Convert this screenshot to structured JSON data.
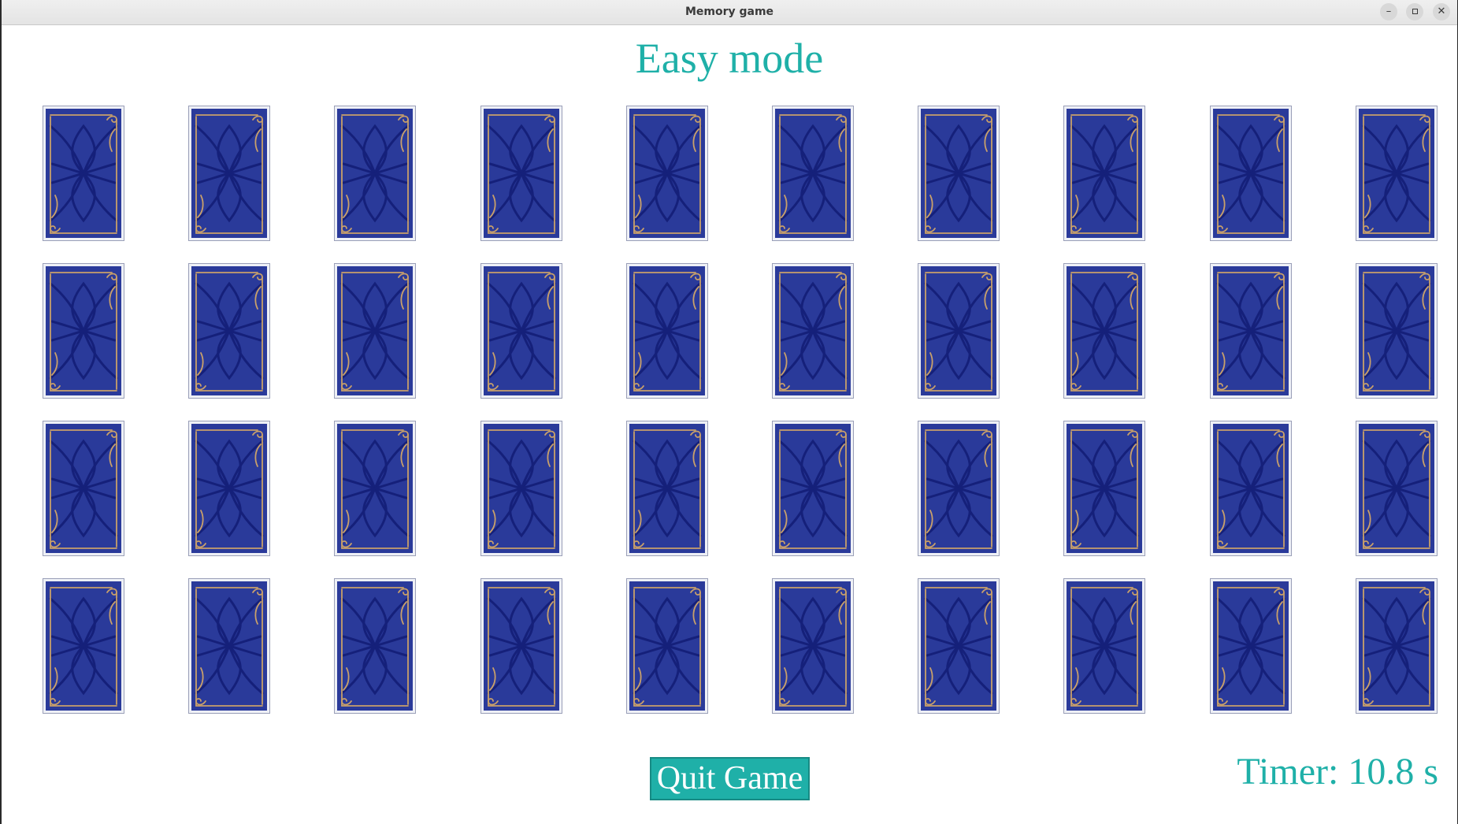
{
  "window": {
    "title": "Memory game",
    "controls": [
      "minimize",
      "maximize",
      "close"
    ]
  },
  "game": {
    "mode_title": "Easy mode",
    "rows": 4,
    "columns": 10,
    "cards_face_down": 40,
    "quit_label": "Quit Game",
    "timer_text": "Timer: 10.8 s"
  },
  "colors": {
    "accent": "#1fb0a8",
    "card_back": "#2a3a9a",
    "card_pattern": "#15207a",
    "card_trim": "#c9a06a"
  }
}
